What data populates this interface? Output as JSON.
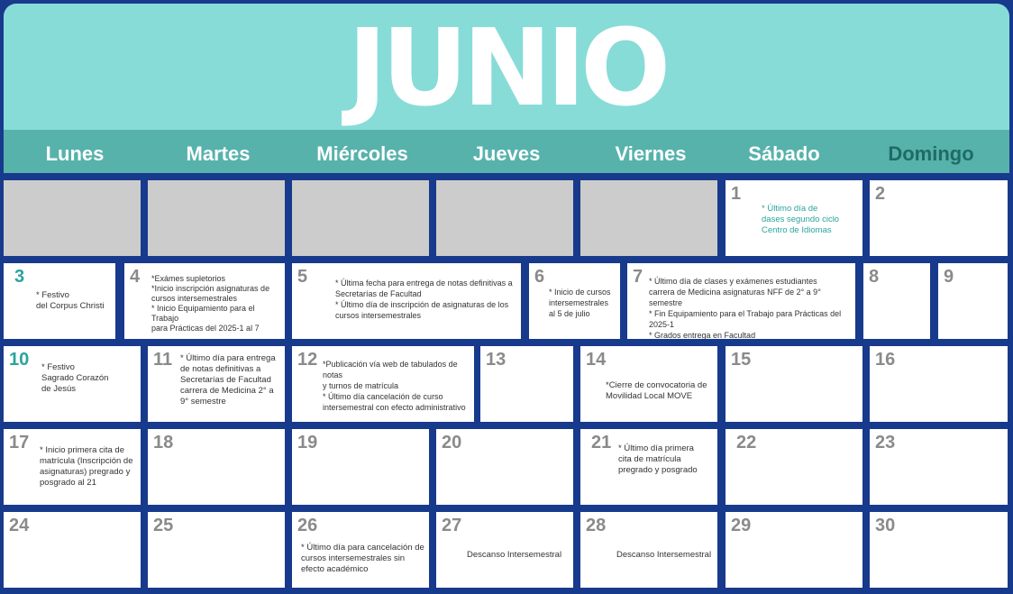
{
  "title": "JUNIO",
  "weekdays": [
    "Lunes",
    "Martes",
    "Miércoles",
    "Jueves",
    "Viernes",
    "Sábado",
    "Domingo"
  ],
  "days": {
    "d1": {
      "num": "1",
      "note": "* Último día de\ndases segundo ciclo\nCentro de Idiomas"
    },
    "d2": {
      "num": "2"
    },
    "d3": {
      "num": "3",
      "note": "* Festivo\ndel Corpus Christi"
    },
    "d4": {
      "num": "4",
      "note": "*Exámes supletorios\n*Inicio inscripción asignaturas de\ncursos intersemestrales\n* Inicio Equipamiento para el Trabajo\npara Prácticas del 2025-1 al 7"
    },
    "d5": {
      "num": "5",
      "note": "* Última fecha para entrega de notas definitivas a\nSecretarías de Facultad\n* Último día de inscripción de asignaturas de los\ncursos intersemestrales"
    },
    "d6": {
      "num": "6",
      "note": "* Inicio de cursos\nintersemestrales\nal 5 de julio"
    },
    "d7": {
      "num": "7",
      "note": "* Último día de clases y exámenes estudiantes\ncarrera de Medicina asignaturas NFF de 2° a 9° semestre\n* Fin Equipamiento para el Trabajo para Prácticas del 2025-1\n* Grados entrega en Facultad"
    },
    "d8": {
      "num": "8"
    },
    "d9": {
      "num": "9"
    },
    "d10": {
      "num": "10",
      "note": "* Festivo\nSagrado Corazón\nde Jesús"
    },
    "d11": {
      "num": "11",
      "note": "* Último día para entrega\nde notas definitivas a\nSecretarías de Facultad\ncarrera de Medicina 2° a\n9° semestre"
    },
    "d12": {
      "num": "12",
      "note": "*Publicación vía web de tabulados de notas\ny turnos de matrícula\n* Último día cancelación de curso\nintersemestral con efecto administrativo"
    },
    "d13": {
      "num": "13"
    },
    "d14": {
      "num": "14",
      "note": "*Cierre de convocatoria de\nMovilidad Local MOVE"
    },
    "d15": {
      "num": "15"
    },
    "d16": {
      "num": "16"
    },
    "d17": {
      "num": "17",
      "note": "* Inicio primera cita de\nmatrícula (Inscripción de\nasignaturas) pregrado y\nposgrado al 21"
    },
    "d18": {
      "num": "18"
    },
    "d19": {
      "num": "19"
    },
    "d20": {
      "num": "20"
    },
    "d21": {
      "num": "21",
      "note": "* Último día primera\ncita de matrícula\npregrado y posgrado"
    },
    "d22": {
      "num": "22"
    },
    "d23": {
      "num": "23"
    },
    "d24": {
      "num": "24"
    },
    "d25": {
      "num": "25"
    },
    "d26": {
      "num": "26",
      "note": "* Último día para cancelación de\ncursos intersemestrales sin\nefecto académico"
    },
    "d27": {
      "num": "27",
      "note": "Descanso Intersemestral"
    },
    "d28": {
      "num": "28",
      "note": "Descanso Intersemestral"
    },
    "d29": {
      "num": "29"
    },
    "d30": {
      "num": "30"
    }
  },
  "colors": {
    "background": "#173a8c",
    "header": "#87dcd8",
    "weekday_bar": "#57b2ac",
    "holiday": "#2ba39d",
    "empty_cell": "#cccccc"
  }
}
